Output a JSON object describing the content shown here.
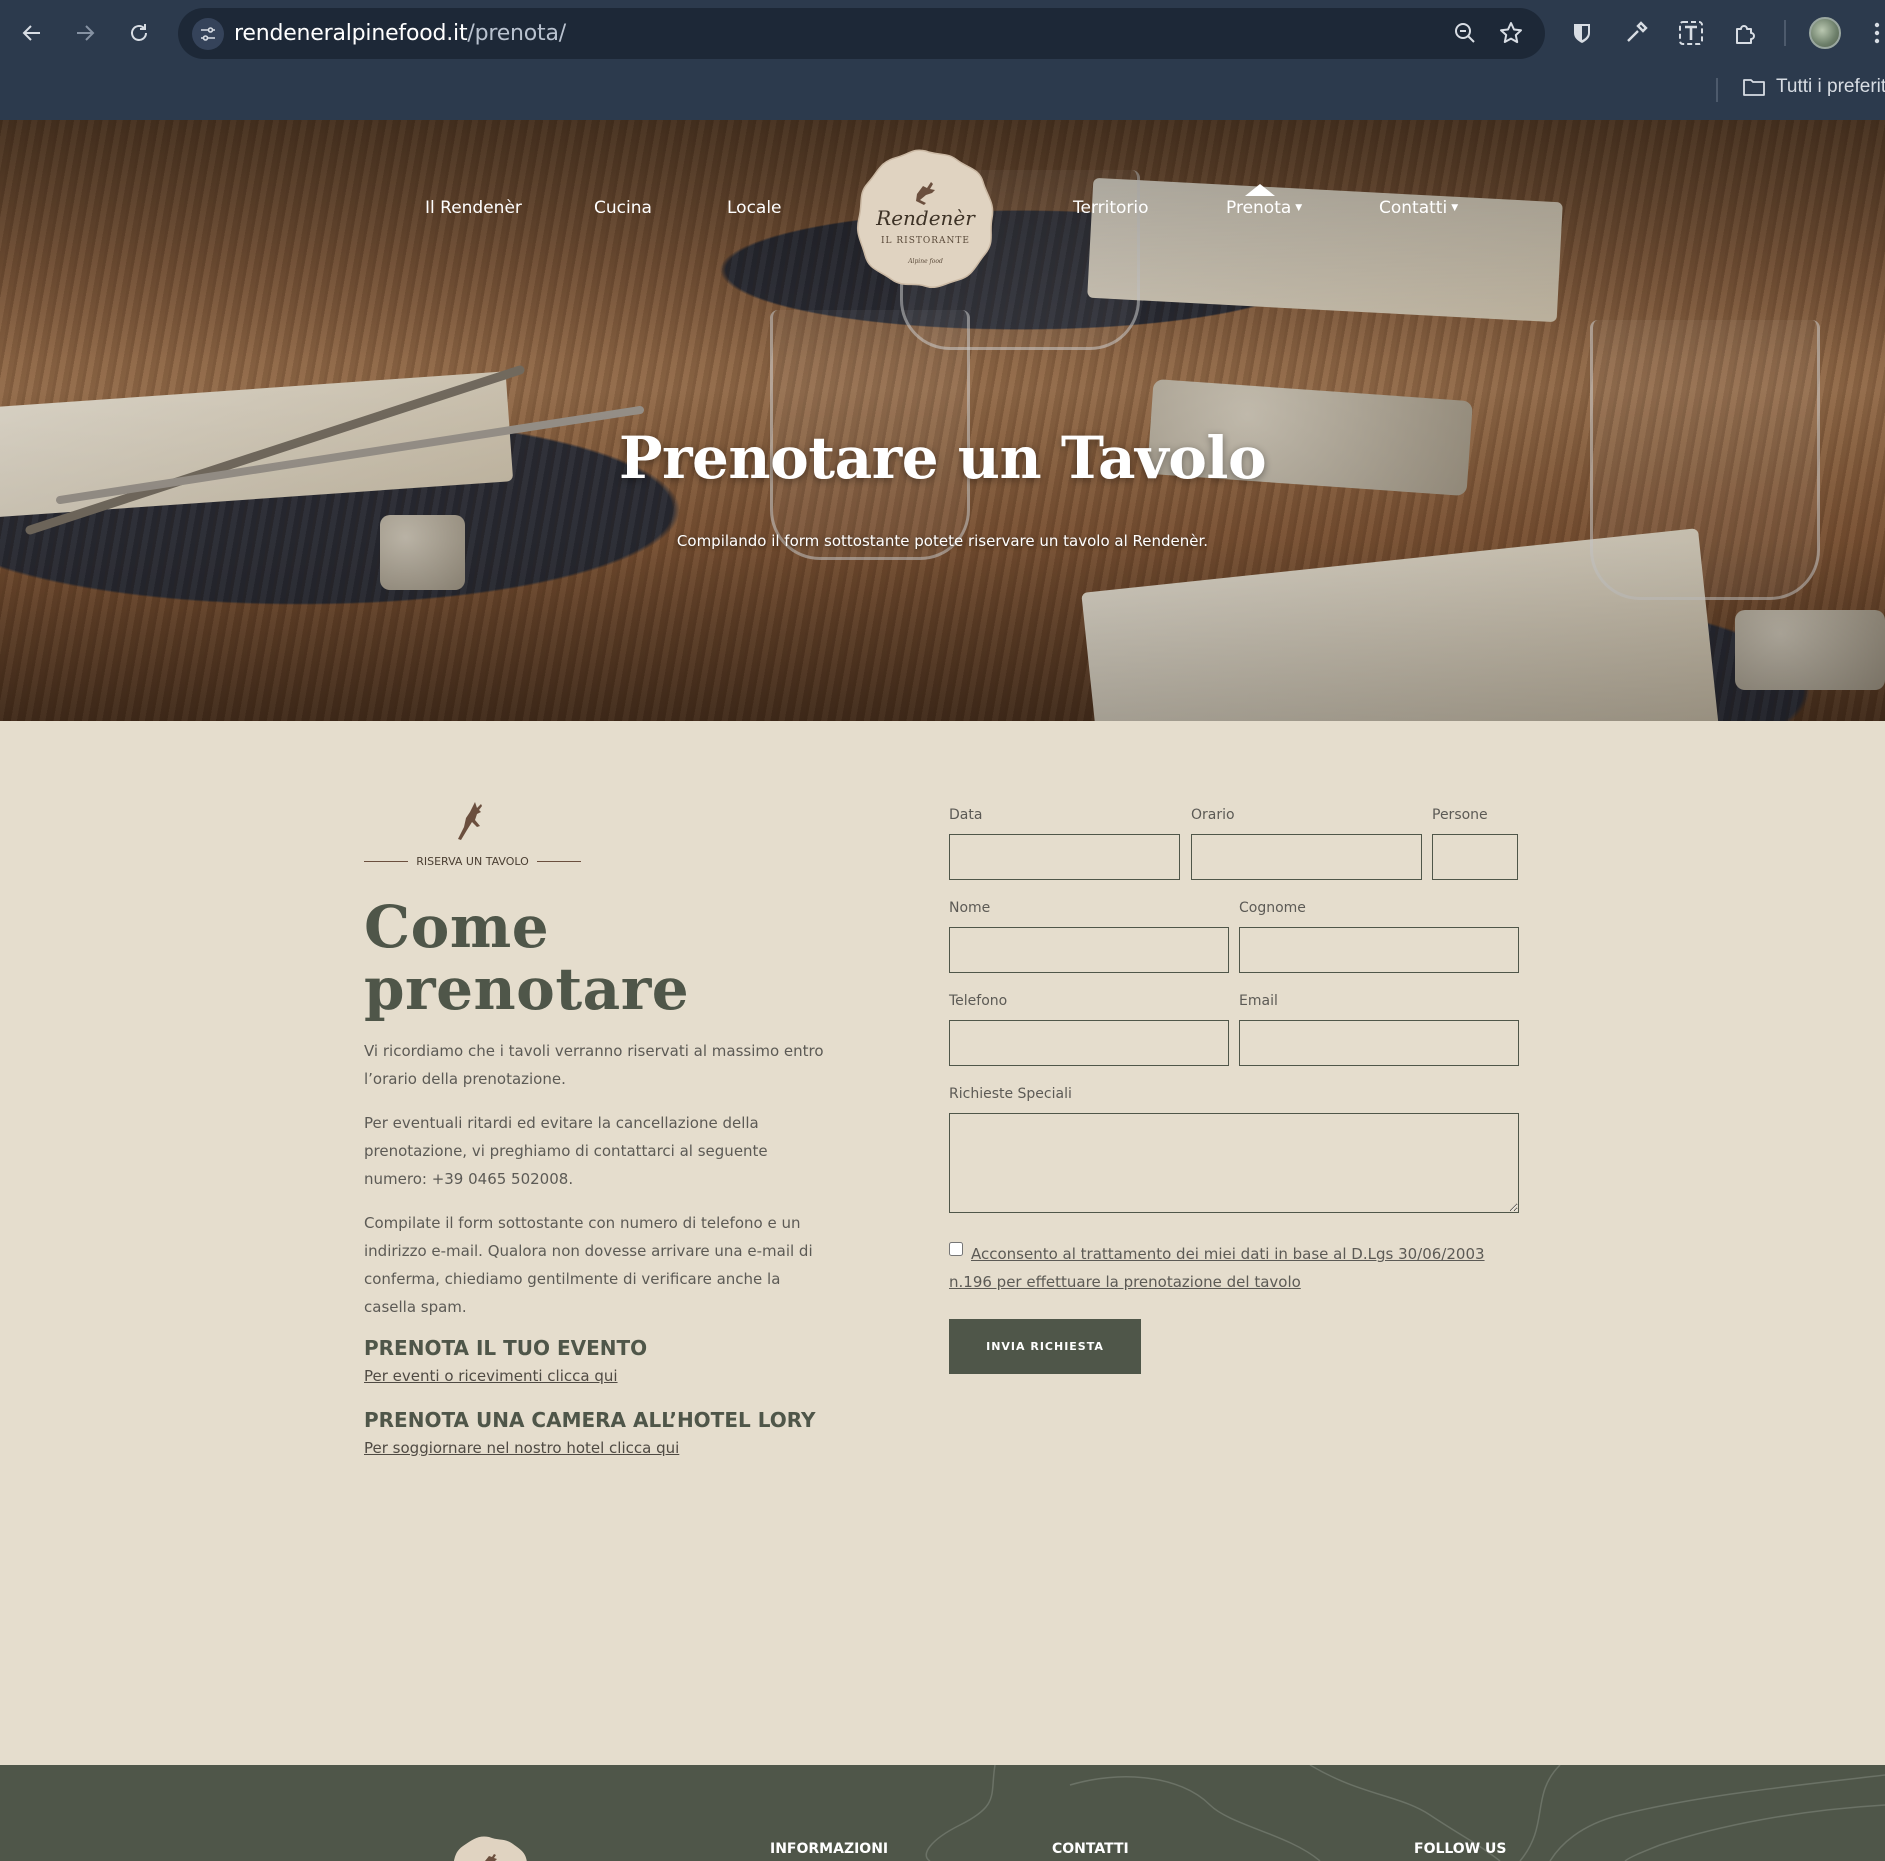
{
  "browser": {
    "url_host": "rendeneralpinefood.it",
    "url_path": "/prenota/",
    "bookmarks_folder": "Tutti i preferiti"
  },
  "nav": {
    "items": [
      {
        "label": "Il Rendenèr"
      },
      {
        "label": "Cucina"
      },
      {
        "label": "Locale"
      },
      {
        "label": "Territorio"
      },
      {
        "label": "Prenota"
      },
      {
        "label": "Contatti"
      }
    ],
    "logo": {
      "brand": "Rendenèr",
      "sub": "IL RISTORANTE",
      "tag": "Alpine food"
    }
  },
  "hero": {
    "title": "Prenotare un Tavolo",
    "subtitle": "Compilando il form sottostante potete riservare un tavolo al Rendenèr."
  },
  "intro": {
    "eyebrow": "RISERVA UN TAVOLO",
    "heading_line1": "Come",
    "heading_line2": "prenotare",
    "paragraphs": [
      "Vi ricordiamo che i tavoli verranno riservati al massimo entro l’orario della prenotazione.",
      "Per eventuali ritardi ed evitare la cancellazione della prenotazione, vi preghiamo di contattarci al seguente numero: +39 0465 502008.",
      "Compilate il form sottostante con numero di telefono e un indirizzo e-mail. Qualora non dovesse arrivare una e-mail di conferma, chiediamo gentilmente di verificare anche la casella spam."
    ],
    "event_heading": "PRENOTA IL TUO EVENTO",
    "event_link": "Per eventi o ricevimenti clicca qui",
    "hotel_heading": "PRENOTA UNA CAMERA ALL’HOTEL LORY",
    "hotel_link": "Per soggiornare nel nostro hotel clicca qui"
  },
  "form": {
    "labels": {
      "data": "Data",
      "orario": "Orario",
      "persone": "Persone",
      "nome": "Nome",
      "cognome": "Cognome",
      "telefono": "Telefono",
      "email": "Email",
      "richieste": "Richieste Speciali"
    },
    "values": {
      "data": "",
      "orario": "",
      "persone": "",
      "nome": "",
      "cognome": "",
      "telefono": "",
      "email": "",
      "richieste": ""
    },
    "consent": "Acconsento al trattamento dei miei dati in base al D.Lgs 30/06/2003 n.196 per effettuare la prenotazione del tavolo",
    "submit": "INVIA RICHIESTA"
  },
  "footer": {
    "headings": [
      "INFORMAZIONI",
      "CONTATTI",
      "FOLLOW US"
    ]
  },
  "colors": {
    "page_bg": "#e5ddcd",
    "accent": "#4f5649",
    "footer_bg": "#4f5649",
    "logo_bg": "#e0d3c1"
  }
}
